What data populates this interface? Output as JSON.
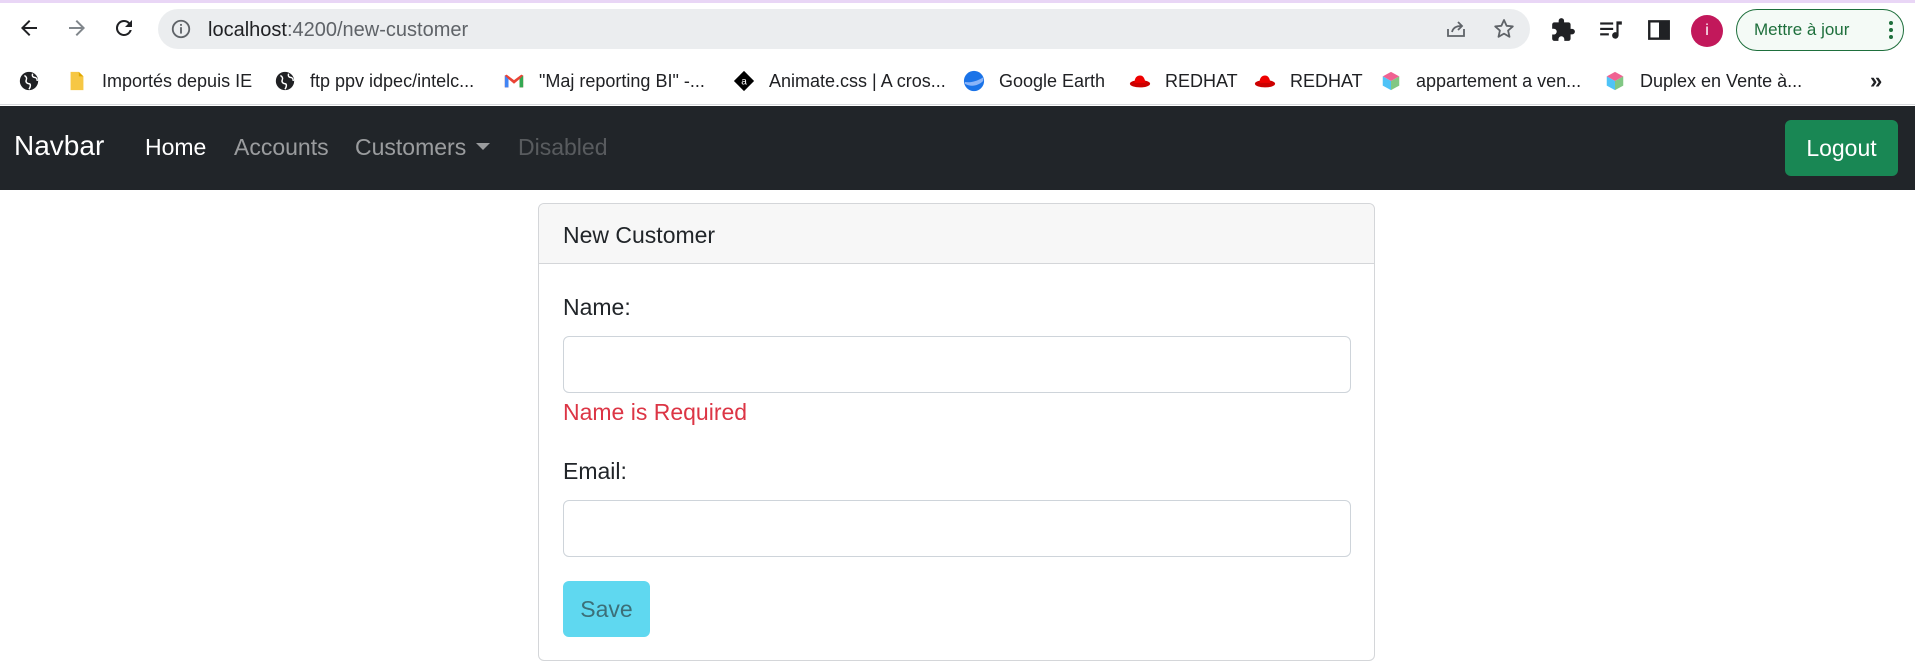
{
  "browser": {
    "url_host": "localhost",
    "url_path": ":4200/new-customer",
    "update_label": "Mettre à jour",
    "avatar_letter": "i",
    "bookmarks": [
      {
        "label": "Importés depuis IE",
        "icon": "folder-icon"
      },
      {
        "label": "ftp ppv idpec/intelc...",
        "icon": "globe-icon"
      },
      {
        "label": "\"Maj reporting BI\" -...",
        "icon": "gmail-icon"
      },
      {
        "label": "Animate.css | A cros...",
        "icon": "animate-icon"
      },
      {
        "label": "Google Earth",
        "icon": "earth-icon"
      },
      {
        "label": "REDHAT",
        "icon": "redhat-icon"
      },
      {
        "label": "REDHAT",
        "icon": "redhat-icon"
      },
      {
        "label": "appartement a ven...",
        "icon": "cube-icon"
      },
      {
        "label": "Duplex en Vente à...",
        "icon": "cube-icon"
      }
    ],
    "more_label": "»"
  },
  "navbar": {
    "brand": "Navbar",
    "links": {
      "home": "Home",
      "accounts": "Accounts",
      "customers": "Customers",
      "disabled": "Disabled"
    },
    "logout": "Logout"
  },
  "card": {
    "title": "New Customer",
    "name_label": "Name:",
    "name_value": "",
    "name_error": "Name is Required",
    "email_label": "Email:",
    "email_value": "",
    "save_label": "Save"
  },
  "colors": {
    "navbar_bg": "#212529",
    "logout_bg": "#198754",
    "error": "#dc3545",
    "save_bg": "#5fd8f0"
  }
}
